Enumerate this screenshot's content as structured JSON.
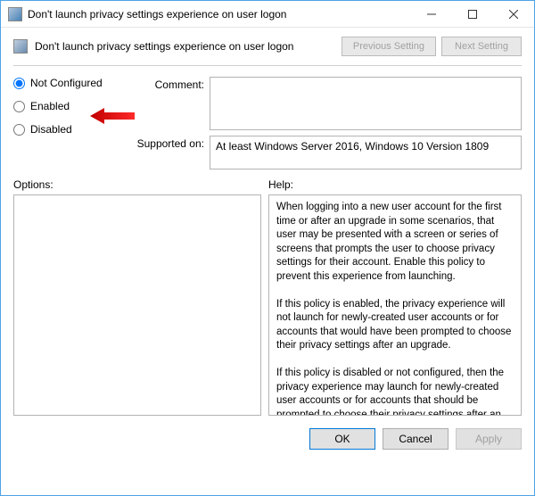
{
  "window": {
    "title": "Don't launch privacy settings experience on user logon"
  },
  "header": {
    "title": "Don't launch privacy settings experience on user logon",
    "prev_label": "Previous Setting",
    "next_label": "Next Setting"
  },
  "radios": {
    "not_configured": "Not Configured",
    "enabled": "Enabled",
    "disabled": "Disabled",
    "selected": "not_configured"
  },
  "labels": {
    "comment": "Comment:",
    "supported": "Supported on:",
    "options": "Options:",
    "help": "Help:"
  },
  "fields": {
    "comment": "",
    "supported": "At least Windows Server 2016, Windows 10 Version 1809"
  },
  "help_text": "When logging into a new user account for the first time or after an upgrade in some scenarios, that user may be presented with a screen or series of screens that prompts the user to choose privacy settings for their account. Enable this policy to prevent this experience from launching.\n\nIf this policy is enabled, the privacy experience will not launch for newly-created user accounts or for accounts that would have been prompted to choose their privacy settings after an upgrade.\n\nIf this policy is disabled or not configured, then the privacy experience may launch for newly-created user accounts or for accounts that should be prompted to choose their privacy settings after an upgrade.",
  "buttons": {
    "ok": "OK",
    "cancel": "Cancel",
    "apply": "Apply"
  }
}
